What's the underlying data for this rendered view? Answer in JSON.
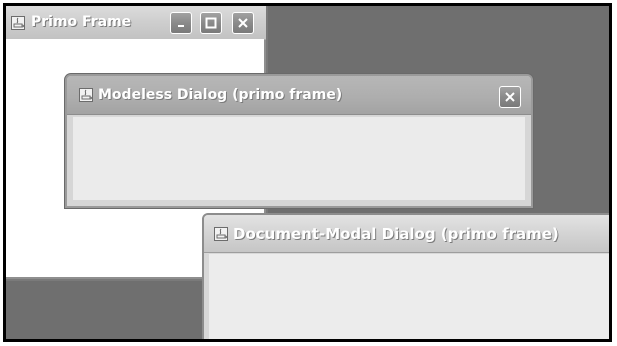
{
  "desktop": {
    "main_frame": {
      "title": "Primo Frame",
      "icon": "java-icon",
      "controls": {
        "minimize": "minimize-icon",
        "maximize": "maximize-icon",
        "close": "close-icon"
      }
    },
    "modeless_dialog": {
      "title": "Modeless Dialog (primo frame)",
      "icon": "java-icon",
      "controls": {
        "close": "close-icon"
      }
    },
    "document_modal_dialog": {
      "title": "Document-Modal Dialog (primo frame)",
      "icon": "java-icon"
    }
  }
}
